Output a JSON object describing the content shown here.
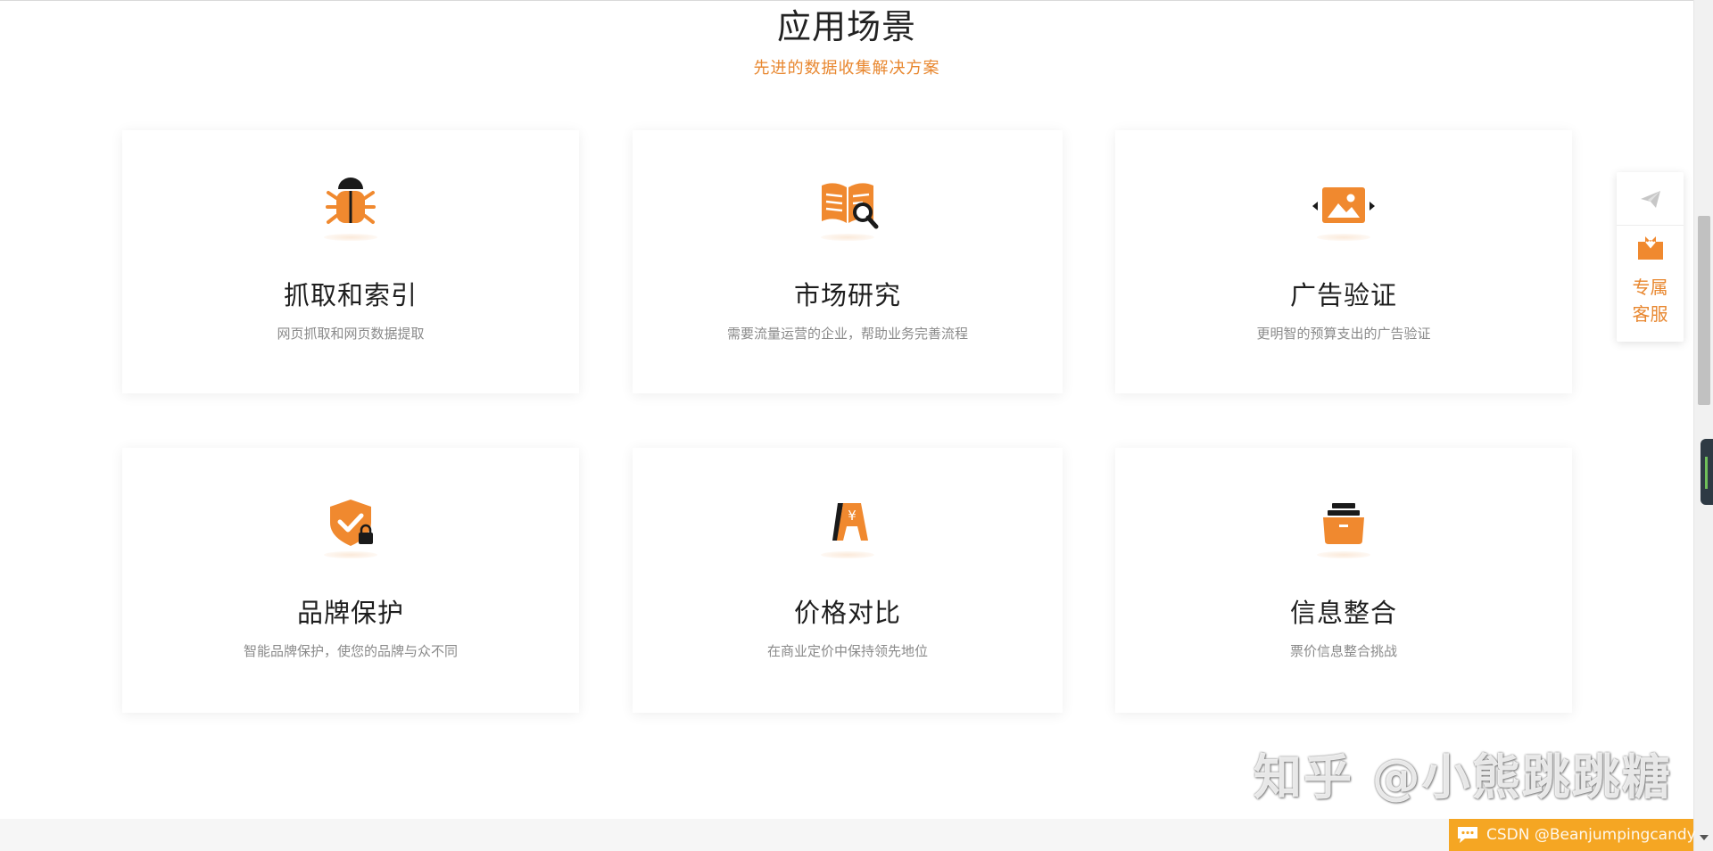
{
  "section": {
    "title": "应用场景",
    "subtitle": "先进的数据收集解决方案"
  },
  "cards": [
    {
      "title": "抓取和索引",
      "desc": "网页抓取和网页数据提取",
      "icon": "bug-icon"
    },
    {
      "title": "市场研究",
      "desc": "需要流量运营的企业，帮助业务完善流程",
      "icon": "book-search-icon"
    },
    {
      "title": "广告验证",
      "desc": "更明智的预算支出的广告验证",
      "icon": "image-ad-icon"
    },
    {
      "title": "品牌保护",
      "desc": "智能品牌保护，使您的品牌与众不同",
      "icon": "shield-lock-icon"
    },
    {
      "title": "价格对比",
      "desc": "在商业定价中保持领先地位",
      "icon": "price-sign-icon"
    },
    {
      "title": "信息整合",
      "desc": "票价信息整合挑战",
      "icon": "archive-drawer-icon"
    }
  ],
  "float_bar": {
    "service_label_line1": "专属",
    "service_label_line2": "客服"
  },
  "watermark": "知乎 @小熊跳跳糖",
  "csdn_badge": "CSDN @Beanjumpingcandy",
  "colors": {
    "accent": "#e8872f",
    "icon_orange": "#f0892f",
    "icon_dark": "#1a1a1a"
  }
}
